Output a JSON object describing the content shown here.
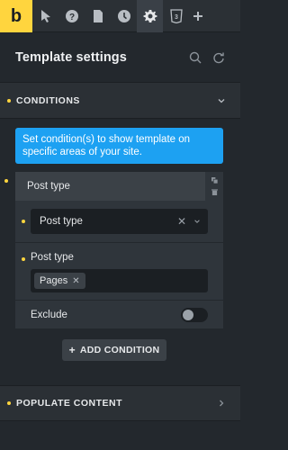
{
  "app": {
    "brand_letter": "b",
    "toolbar_icons": [
      "pointer-icon",
      "help-icon",
      "page-icon",
      "history-icon",
      "settings-icon",
      "css3-icon",
      "add-icon"
    ]
  },
  "panel": {
    "title": "Template settings"
  },
  "sections": {
    "conditions": {
      "label": "CONDITIONS",
      "expanded": true
    },
    "populate": {
      "label": "POPULATE CONTENT",
      "expanded": false
    }
  },
  "info": {
    "text": "Set condition(s) to show template on specific areas of your site."
  },
  "condition": {
    "card_title": "Post type",
    "type_select_value": "Post type",
    "post_type_label": "Post type",
    "post_type_tags": [
      "Pages"
    ],
    "exclude_label": "Exclude",
    "exclude_on": false
  },
  "add_condition": {
    "label": "ADD CONDITION",
    "plus": "+"
  },
  "colors": {
    "brand": "#ffd53e",
    "info_blue": "#1da1f2",
    "bg_dark": "#23282d",
    "input_bg": "#1b1f23"
  }
}
